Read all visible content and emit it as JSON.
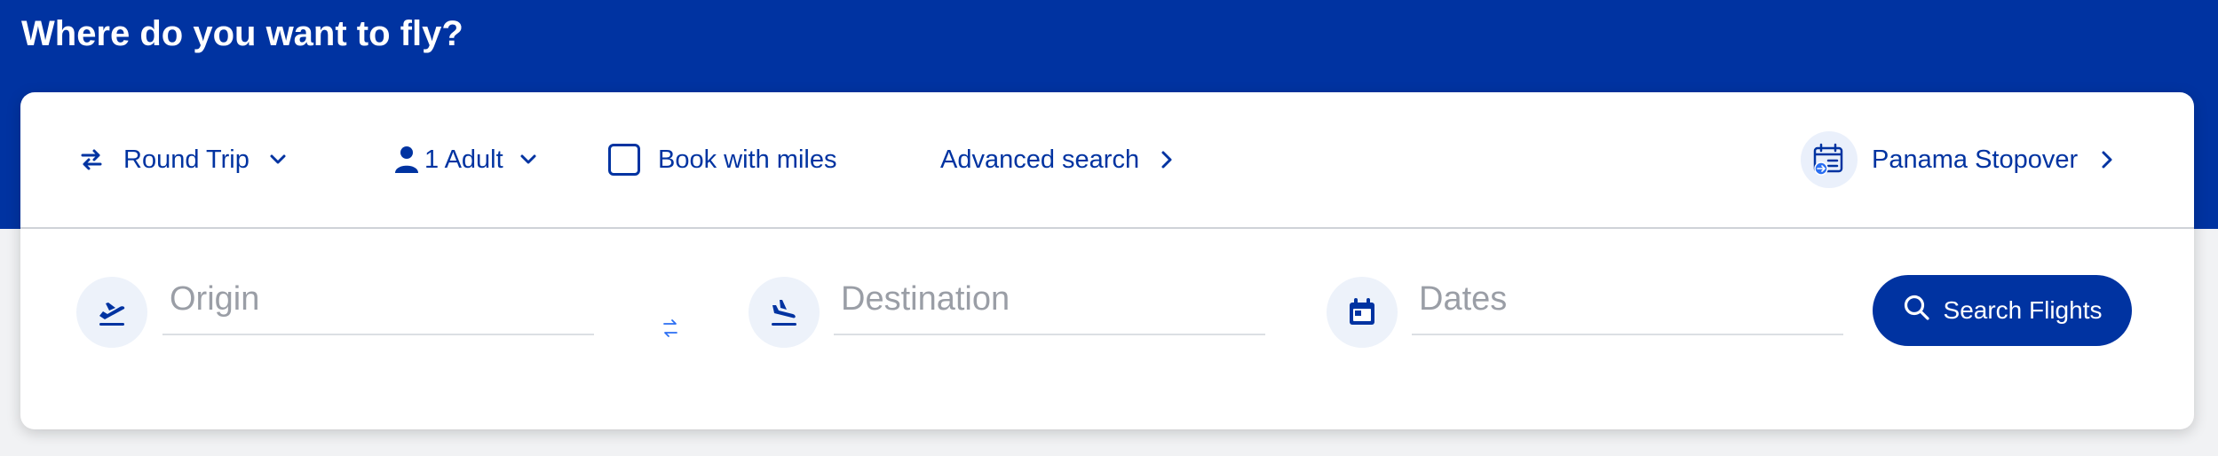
{
  "header": {
    "title": "Where do you want to fly?"
  },
  "options": {
    "trip_type": "Round Trip",
    "passengers": "1 Adult",
    "book_with_miles": {
      "label": "Book with miles",
      "checked": false
    },
    "advanced_search": "Advanced search",
    "stopover": "Panama Stopover"
  },
  "search": {
    "origin": {
      "placeholder": "Origin",
      "value": ""
    },
    "destination": {
      "placeholder": "Destination",
      "value": ""
    },
    "dates": {
      "placeholder": "Dates",
      "value": ""
    },
    "button_label": "Search Flights"
  },
  "icons": {
    "trip_type": "swap-arrows-icon",
    "trip_chevron": "chevron-down-icon",
    "passenger": "person-icon",
    "passenger_chevron": "chevron-down-icon",
    "advanced": "chevron-right-icon",
    "stopover": "calendar-plane-icon",
    "stopover_chevron": "chevron-right-icon",
    "origin": "plane-departure-icon",
    "swap": "swap-vertical-arrows-icon",
    "destination": "plane-arrival-icon",
    "dates": "calendar-icon",
    "search": "search-icon"
  },
  "colors": {
    "brand_blue": "#0033a1",
    "accent_blue": "#2b6ff2",
    "icon_bg": "#edf2fa",
    "placeholder_grey": "#9a9ea6"
  }
}
